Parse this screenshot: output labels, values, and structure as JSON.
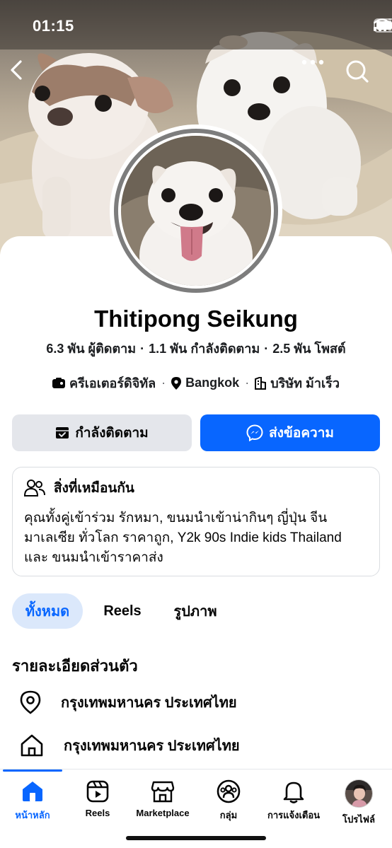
{
  "status_bar": {
    "time": "01:15"
  },
  "cover": {
    "icons": [
      "back-icon",
      "more-icon",
      "search-icon"
    ]
  },
  "profile": {
    "name": "Thitipong Seikung",
    "stats": {
      "followers": "6.3 พัน ผู้ติดตาม",
      "following": "1.1 พัน กำลังติดตาม",
      "posts": "2.5 พัน โพสต์"
    },
    "meta": {
      "category": "ครีเอเตอร์ดิจิทัล",
      "location": "Bangkok",
      "workplace": "บริษัท ม้าเร็ว"
    }
  },
  "actions": {
    "following_label": "กำลังติดตาม",
    "message_label": "ส่งข้อความ"
  },
  "common": {
    "title": "สิ่งที่เหมือนกัน",
    "line1": "คุณทั้งคู่เข้าร่วม รักหมา, ขนมนำเข้าน่ากินๆ ญี่ปุ่น จีน",
    "line2": "มาเลเซีย ทั่วโลก ราคาถูก, Y2k 90s Indie kids Thailand",
    "line3": "และ ขนมนำเข้าราคาส่ง"
  },
  "tabs": [
    "ทั้งหมด",
    "Reels",
    "รูปภาพ"
  ],
  "details": {
    "title": "รายละเอียดส่วนตัว",
    "current_city": "กรุงเทพมหานคร ประเทศไทย",
    "hometown": "กรุงเทพมหานคร ประเทศไทย"
  },
  "tabbar": {
    "home": "หน้าหลัก",
    "reels": "Reels",
    "marketplace": "Marketplace",
    "groups": "กลุ่ม",
    "notifications": "การแจ้งเตือน",
    "profile": "โปรไฟล์"
  },
  "colors": {
    "accent": "#0866ff",
    "tab_active_bg": "#dbe8fb",
    "button_gray": "#e4e6eb"
  }
}
